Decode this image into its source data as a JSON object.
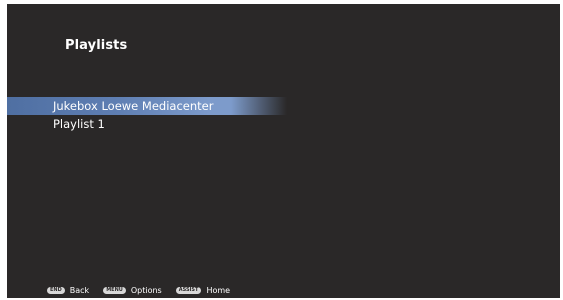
{
  "header": {
    "title": "Playlists"
  },
  "playlists": [
    {
      "label": "Jukebox Loewe Mediacenter",
      "selected": true
    },
    {
      "label": "Playlist 1",
      "selected": false
    }
  ],
  "footer": {
    "hints": [
      {
        "key": "END",
        "label": "Back",
        "key_icon": "end-key-icon"
      },
      {
        "key": "MENU",
        "label": "Options",
        "key_icon": "menu-key-icon"
      },
      {
        "key": "ASSIST",
        "label": "Home",
        "key_icon": "assist-key-icon"
      }
    ]
  },
  "colors": {
    "background": "#2a2828",
    "selection": "#7d9bcb",
    "text": "#ffffff"
  }
}
